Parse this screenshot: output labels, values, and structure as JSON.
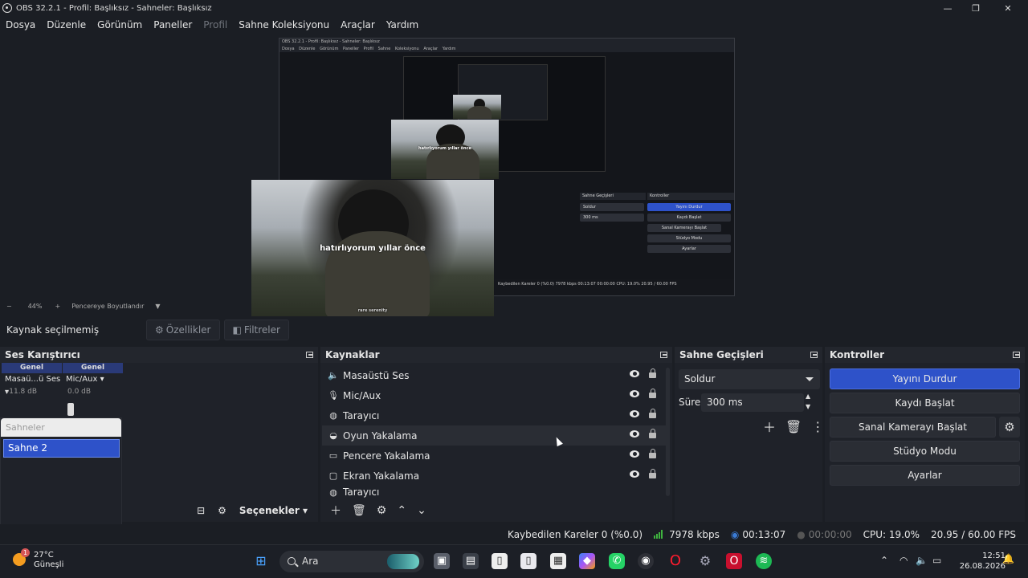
{
  "window": {
    "title": "OBS 32.2.1 - Profil: Başlıksız - Sahneler: Başlıksız",
    "minimize": "—",
    "maximize": "❐",
    "close": "✕"
  },
  "menu": {
    "items": [
      "Dosya",
      "Düzenle",
      "Görünüm",
      "Paneller",
      "Profil",
      "Sahne Koleksiyonu",
      "Araçlar",
      "Yardım"
    ]
  },
  "preview": {
    "mini_title": "OBS 32.2.1 - Profil: Başlıksız - Sahneler: Başlıksız",
    "mini_menu": "Dosya Düzenle Görünüm Paneller Profil Sahne Koleksiyonu Araçlar Yardım",
    "caption": "hatırlıyorum yıllar önce",
    "credit": "rare serenity",
    "mini_panel_transitions": "Sahne Geçişleri",
    "mini_panel_controls": "Kontroller",
    "mini_buttons": [
      "Yayını Durdur",
      "Kaydı Başlat",
      "Sanal Kamerayı Başlat",
      "Stüdyo Modu",
      "Ayarlar"
    ],
    "mini_transition": "Soldur",
    "mini_duration_label": "Süre",
    "mini_duration": "300 ms",
    "mini_status": "Kaybedilen Kareler 0 (%0.0)   7978 kbps   00:13:07   00:00:00   CPU: 19.0%   20.95 / 60.00 FPS"
  },
  "zoom": {
    "minus": "−",
    "value": "44%",
    "plus": "+",
    "fit": "Pencereye Boyutlandır"
  },
  "source_toolbar": {
    "status": "Kaynak seçilmemiş",
    "properties": "Özellikler",
    "filters": "Filtreler"
  },
  "mixer": {
    "title": "Ses Karıştırıcı",
    "channels": [
      {
        "header": "Genel",
        "name": "Masaü...ü Ses",
        "db": "-11.8 dB"
      },
      {
        "header": "Genel",
        "name": "Mic/Aux",
        "db": "0.0 dB"
      }
    ],
    "options": "Seçenekler"
  },
  "scenes": {
    "title": "Sahneler",
    "items": [
      "Sahne 2"
    ]
  },
  "sources": {
    "title": "Kaynaklar",
    "items": [
      {
        "name": "Masaüstü Ses",
        "icon": "speaker-icon"
      },
      {
        "name": "Mic/Aux",
        "icon": "microphone-icon"
      },
      {
        "name": "Tarayıcı",
        "icon": "globe-icon"
      },
      {
        "name": "Oyun Yakalama",
        "icon": "gamepad-icon"
      },
      {
        "name": "Pencere Yakalama",
        "icon": "window-icon"
      },
      {
        "name": "Ekran Yakalama",
        "icon": "monitor-icon"
      },
      {
        "name": "Tarayıcı",
        "icon": "globe-icon"
      }
    ]
  },
  "transitions": {
    "title": "Sahne Geçişleri",
    "selected": "Soldur",
    "duration_label": "Süre",
    "duration": "300 ms"
  },
  "controls": {
    "title": "Kontroller",
    "stop_stream": "Yayını Durdur",
    "start_record": "Kaydı Başlat",
    "virtual_cam": "Sanal Kamerayı Başlat",
    "studio_mode": "Stüdyo Modu",
    "settings": "Ayarlar"
  },
  "status": {
    "dropped": "Kaybedilen Kareler 0 (%0.0)",
    "bitrate": "7978 kbps",
    "stream_time": "00:13:07",
    "record_time": "00:00:00",
    "cpu": "CPU: 19.0%",
    "fps": "20.95 / 60.00 FPS"
  },
  "taskbar": {
    "temp": "27°C",
    "weather": "Güneşli",
    "badge": "1",
    "search": "Ara",
    "time": "12:51",
    "date": "26.08.2026"
  },
  "colors": {
    "accent": "#2e52c9",
    "bg": "#1b1e24",
    "dock": "#1f2229"
  }
}
